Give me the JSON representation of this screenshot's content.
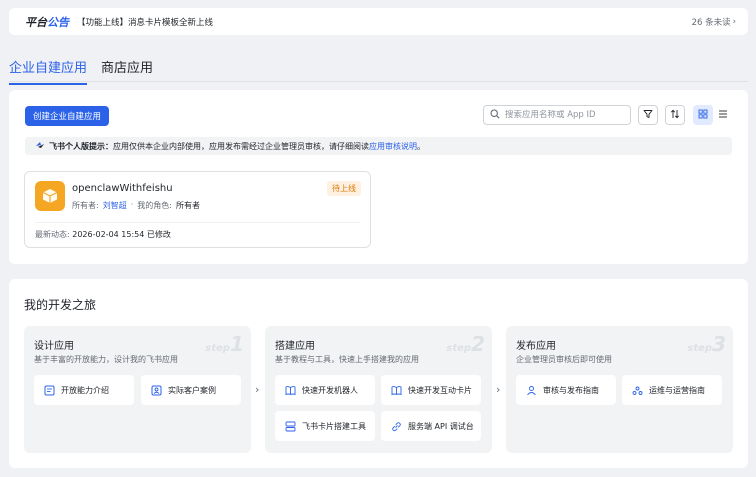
{
  "announcement": {
    "label_part1": "平台",
    "label_part2": "公告",
    "message": "【功能上线】消息卡片模板全新上线",
    "unread": "26 条未读",
    "unread_chevron": "›"
  },
  "tabs": [
    {
      "label": "企业自建应用",
      "active": true
    },
    {
      "label": "商店应用",
      "active": false
    }
  ],
  "toolbar": {
    "create_label": "创建企业自建应用",
    "search_placeholder": "搜索应用名称或 App ID",
    "icons": [
      "filter-icon",
      "sort-icon",
      "grid-view-icon",
      "list-view-icon"
    ]
  },
  "notice": {
    "title": "飞书个人版提示：",
    "text": "应用仅供本企业内部使用，应用发布需经过企业管理员审核，请仔细阅读",
    "link": "应用审核说明",
    "end": "。"
  },
  "app": {
    "name": "openclawWithfeishu",
    "status": "待上线",
    "owner_label": "所有者:",
    "owner": "刘智超",
    "separator": "·",
    "role_label": "我的角色:",
    "role": "所有者",
    "update_label": "最新动态:",
    "update": "2026-02-04 15:54 已修改"
  },
  "journey": {
    "title": "我的开发之旅",
    "arrow": "›",
    "steps": [
      {
        "title": "设计应用",
        "desc": "基于丰富的开放能力，设计我的飞书应用",
        "num_word": "step",
        "num": "1",
        "chips": [
          "开放能力介绍",
          "实际客户案例"
        ]
      },
      {
        "title": "搭建应用",
        "desc": "基于教程与工具，快速上手搭建我的应用",
        "num_word": "step",
        "num": "2",
        "chips": [
          "快速开发机器人",
          "快速开发互动卡片",
          "飞书卡片搭建工具",
          "服务端 API 调试台"
        ]
      },
      {
        "title": "发布应用",
        "desc": "企业管理员审核后即可使用",
        "num_word": "step",
        "num": "3",
        "chips": [
          "审核与发布指南",
          "运维与运营指南"
        ]
      }
    ]
  },
  "colors": {
    "accent": "#2b62e8",
    "badge_text": "#de7802",
    "badge_bg": "#fef1e1",
    "app_logo": "#f5a623"
  }
}
